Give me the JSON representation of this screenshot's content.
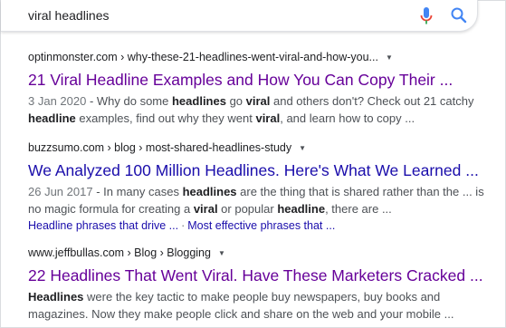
{
  "search": {
    "query": "viral headlines",
    "colors": {
      "mic_blue": "#4285f4",
      "mic_red": "#ea4335",
      "search_blue": "#4285f4"
    }
  },
  "results": [
    {
      "breadcrumb": "optinmonster.com › why-these-21-headlines-went-viral-and-how-you...",
      "title": "21 Viral Headline Examples and How You Can Copy Their ...",
      "title_color": "#660099",
      "snippet": [
        {
          "t": "3 Jan 2020",
          "s": "date"
        },
        {
          "t": " - Why do some ",
          "s": "n"
        },
        {
          "t": "headlines",
          "s": "b"
        },
        {
          "t": " go ",
          "s": "n"
        },
        {
          "t": "viral",
          "s": "b"
        },
        {
          "t": " and others don't? Check out 21 catchy ",
          "s": "n"
        },
        {
          "t": "headline",
          "s": "b"
        },
        {
          "t": " examples, find out why they went ",
          "s": "n"
        },
        {
          "t": "viral",
          "s": "b"
        },
        {
          "t": ", and learn how to copy ...",
          "s": "n"
        }
      ]
    },
    {
      "breadcrumb": "buzzsumo.com › blog › most-shared-headlines-study",
      "title": "We Analyzed 100 Million Headlines. Here's What We Learned ...",
      "title_color": "#1a0dab",
      "snippet": [
        {
          "t": "26 Jun 2017",
          "s": "date"
        },
        {
          "t": " - In many cases ",
          "s": "n"
        },
        {
          "t": "headlines",
          "s": "b"
        },
        {
          "t": " are the thing that is shared rather than the ... is no magic formula for creating a ",
          "s": "n"
        },
        {
          "t": "viral",
          "s": "b"
        },
        {
          "t": " or popular ",
          "s": "n"
        },
        {
          "t": "headline",
          "s": "b"
        },
        {
          "t": ", there are ...",
          "s": "n"
        }
      ],
      "sitelinks": [
        "Headline phrases that drive ...",
        "Most effective phrases that ..."
      ]
    },
    {
      "breadcrumb": "www.jeffbullas.com › Blog › Blogging",
      "title": "22 Headlines That Went Viral. Have These Marketers Cracked ...",
      "title_color": "#660099",
      "snippet": [
        {
          "t": "Headlines",
          "s": "b"
        },
        {
          "t": " were the key tactic to make people buy newspapers, buy books and magazines. Now they make people click and share on the web and your mobile ...",
          "s": "n"
        }
      ]
    }
  ]
}
